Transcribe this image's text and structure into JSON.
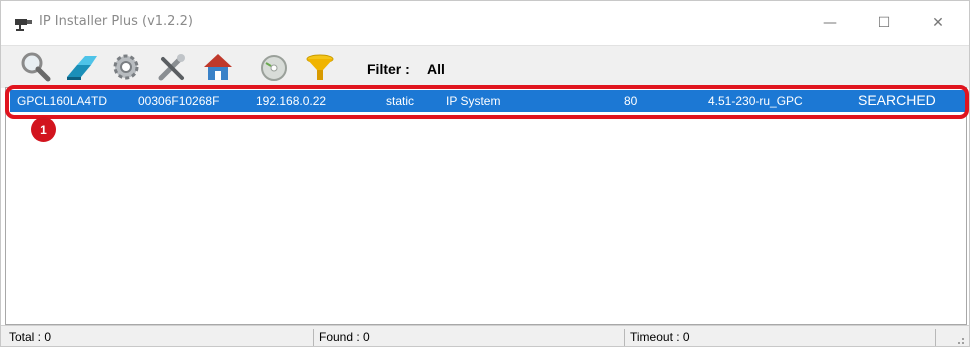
{
  "window": {
    "title": "IP Installer Plus (v1.2.2)",
    "controls": {
      "minimize": "—",
      "maximize": "☐",
      "close": "✕"
    }
  },
  "toolbar": {
    "icons": [
      "search-icon",
      "eraser-icon",
      "settings-gear-icon",
      "tools-icon",
      "home-network-icon",
      "disc-icon",
      "filter-funnel-icon"
    ],
    "filter_label": "Filter :",
    "filter_value": "All"
  },
  "devices": [
    {
      "name": "GPCL160LA4TD",
      "mac": "00306F10268F",
      "ip": "192.168.0.22",
      "mode": "static",
      "type": "IP System",
      "port": "80",
      "version": "4.51-230-ru_GPC",
      "status": "SEARCHED",
      "selected": true
    }
  ],
  "annotation": {
    "badge": "1",
    "color": "#e0141e"
  },
  "statusbar": {
    "total": "Total : 0",
    "found": "Found : 0",
    "timeout": "Timeout : 0"
  },
  "colors": {
    "selection": "#1c78d4",
    "highlight": "#e0141e"
  }
}
